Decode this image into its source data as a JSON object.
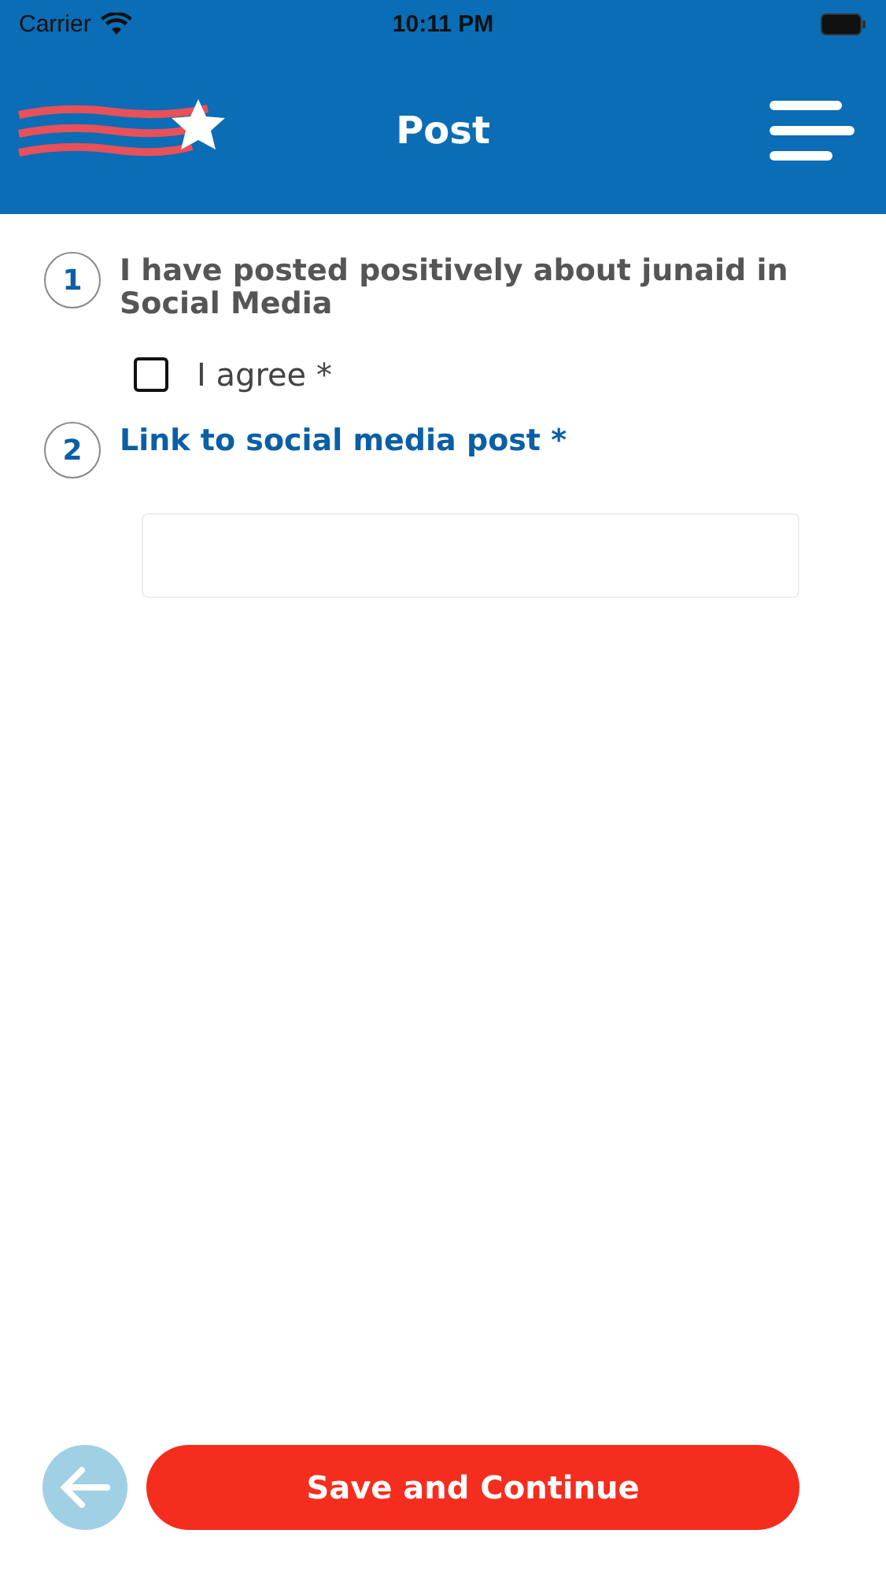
{
  "status_bar": {
    "carrier": "Carrier",
    "time": "10:11 PM"
  },
  "header": {
    "title": "Post"
  },
  "questions": [
    {
      "number": "1",
      "kind": "checkbox",
      "title": "I have posted positively about junaid in Social Media",
      "option": {
        "label": "I agree *",
        "checked": false
      }
    },
    {
      "number": "2",
      "kind": "text",
      "title": "Link to social media post *"
    }
  ],
  "footer": {
    "back_button": {
      "disabled": true
    },
    "submit": "Save and Continue"
  }
}
